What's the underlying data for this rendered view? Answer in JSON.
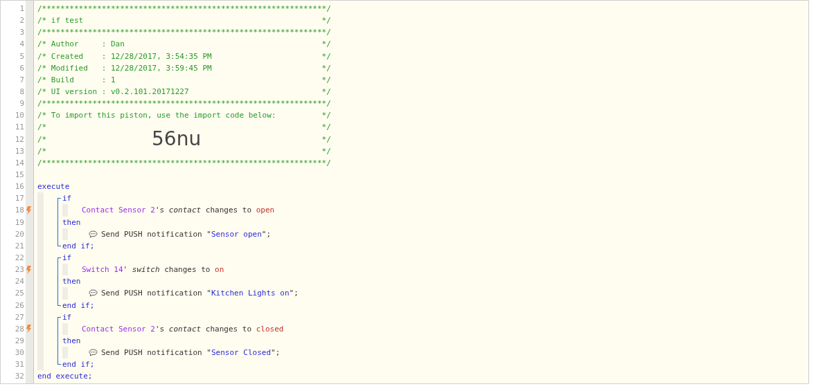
{
  "line_numbers": [
    {
      "n": "1",
      "trigger": false
    },
    {
      "n": "2",
      "trigger": false
    },
    {
      "n": "3",
      "trigger": false
    },
    {
      "n": "4",
      "trigger": false
    },
    {
      "n": "5",
      "trigger": false
    },
    {
      "n": "6",
      "trigger": false
    },
    {
      "n": "7",
      "trigger": false
    },
    {
      "n": "8",
      "trigger": false
    },
    {
      "n": "9",
      "trigger": false
    },
    {
      "n": "10",
      "trigger": false
    },
    {
      "n": "11",
      "trigger": false
    },
    {
      "n": "12",
      "trigger": false
    },
    {
      "n": "13",
      "trigger": false
    },
    {
      "n": "14",
      "trigger": false
    },
    {
      "n": "15",
      "trigger": false
    },
    {
      "n": "16",
      "trigger": false
    },
    {
      "n": "17",
      "trigger": false
    },
    {
      "n": "18",
      "trigger": true
    },
    {
      "n": "19",
      "trigger": false
    },
    {
      "n": "20",
      "trigger": false
    },
    {
      "n": "21",
      "trigger": false
    },
    {
      "n": "22",
      "trigger": false
    },
    {
      "n": "23",
      "trigger": true
    },
    {
      "n": "24",
      "trigger": false
    },
    {
      "n": "25",
      "trigger": false
    },
    {
      "n": "26",
      "trigger": false
    },
    {
      "n": "27",
      "trigger": false
    },
    {
      "n": "28",
      "trigger": true
    },
    {
      "n": "29",
      "trigger": false
    },
    {
      "n": "30",
      "trigger": false
    },
    {
      "n": "31",
      "trigger": false
    },
    {
      "n": "32",
      "trigger": false
    }
  ],
  "header": [
    {
      "kind": "rule",
      "text": "/**************************************************************/"
    },
    {
      "kind": "comment",
      "text": "/* if test",
      "close": "*/"
    },
    {
      "kind": "rule",
      "text": "/**************************************************************/"
    },
    {
      "kind": "comment",
      "text": "/* Author     : Dan",
      "close": "*/"
    },
    {
      "kind": "comment",
      "text": "/* Created    : 12/28/2017, 3:54:35 PM",
      "close": "*/"
    },
    {
      "kind": "comment",
      "text": "/* Modified   : 12/28/2017, 3:59:45 PM",
      "close": "*/"
    },
    {
      "kind": "comment",
      "text": "/* Build      : 1",
      "close": "*/"
    },
    {
      "kind": "comment",
      "text": "/* UI version : v0.2.101.20171227",
      "close": "*/"
    },
    {
      "kind": "rule",
      "text": "/**************************************************************/"
    },
    {
      "kind": "comment",
      "text": "/* To import this piston, use the import code below:",
      "close": "*/"
    },
    {
      "kind": "comment",
      "text": "/*",
      "close": "*/"
    },
    {
      "kind": "import",
      "text": "/*",
      "code": "56nu",
      "close": "*/"
    },
    {
      "kind": "comment",
      "text": "/*",
      "close": "*/"
    },
    {
      "kind": "rule",
      "text": "/**************************************************************/"
    }
  ],
  "program": {
    "start": "execute",
    "end": "end execute;",
    "blocks": [
      {
        "if": "if",
        "condition": {
          "device": "Contact Sensor 2",
          "possessive": "'s",
          "attribute": "contact",
          "operator": "changes to",
          "value": "open"
        },
        "then": "then",
        "action": {
          "text": "Send PUSH notification \"",
          "message": "Sensor open",
          "suffix": "\";"
        },
        "end": "end if;"
      },
      {
        "if": "if",
        "condition": {
          "device": "Switch 14",
          "possessive": "'",
          "attribute": "switch",
          "operator": "changes to",
          "value": "on"
        },
        "then": "then",
        "action": {
          "text": "Send PUSH notification \"",
          "message": "Kitchen Lights on",
          "suffix": "\";"
        },
        "end": "end if;"
      },
      {
        "if": "if",
        "condition": {
          "device": "Contact Sensor 2",
          "possessive": "'s",
          "attribute": "contact",
          "operator": "changes to",
          "value": "closed"
        },
        "then": "then",
        "action": {
          "text": "Send PUSH notification \"",
          "message": "Sensor Closed",
          "suffix": "\";"
        },
        "end": "end if;"
      }
    ]
  }
}
